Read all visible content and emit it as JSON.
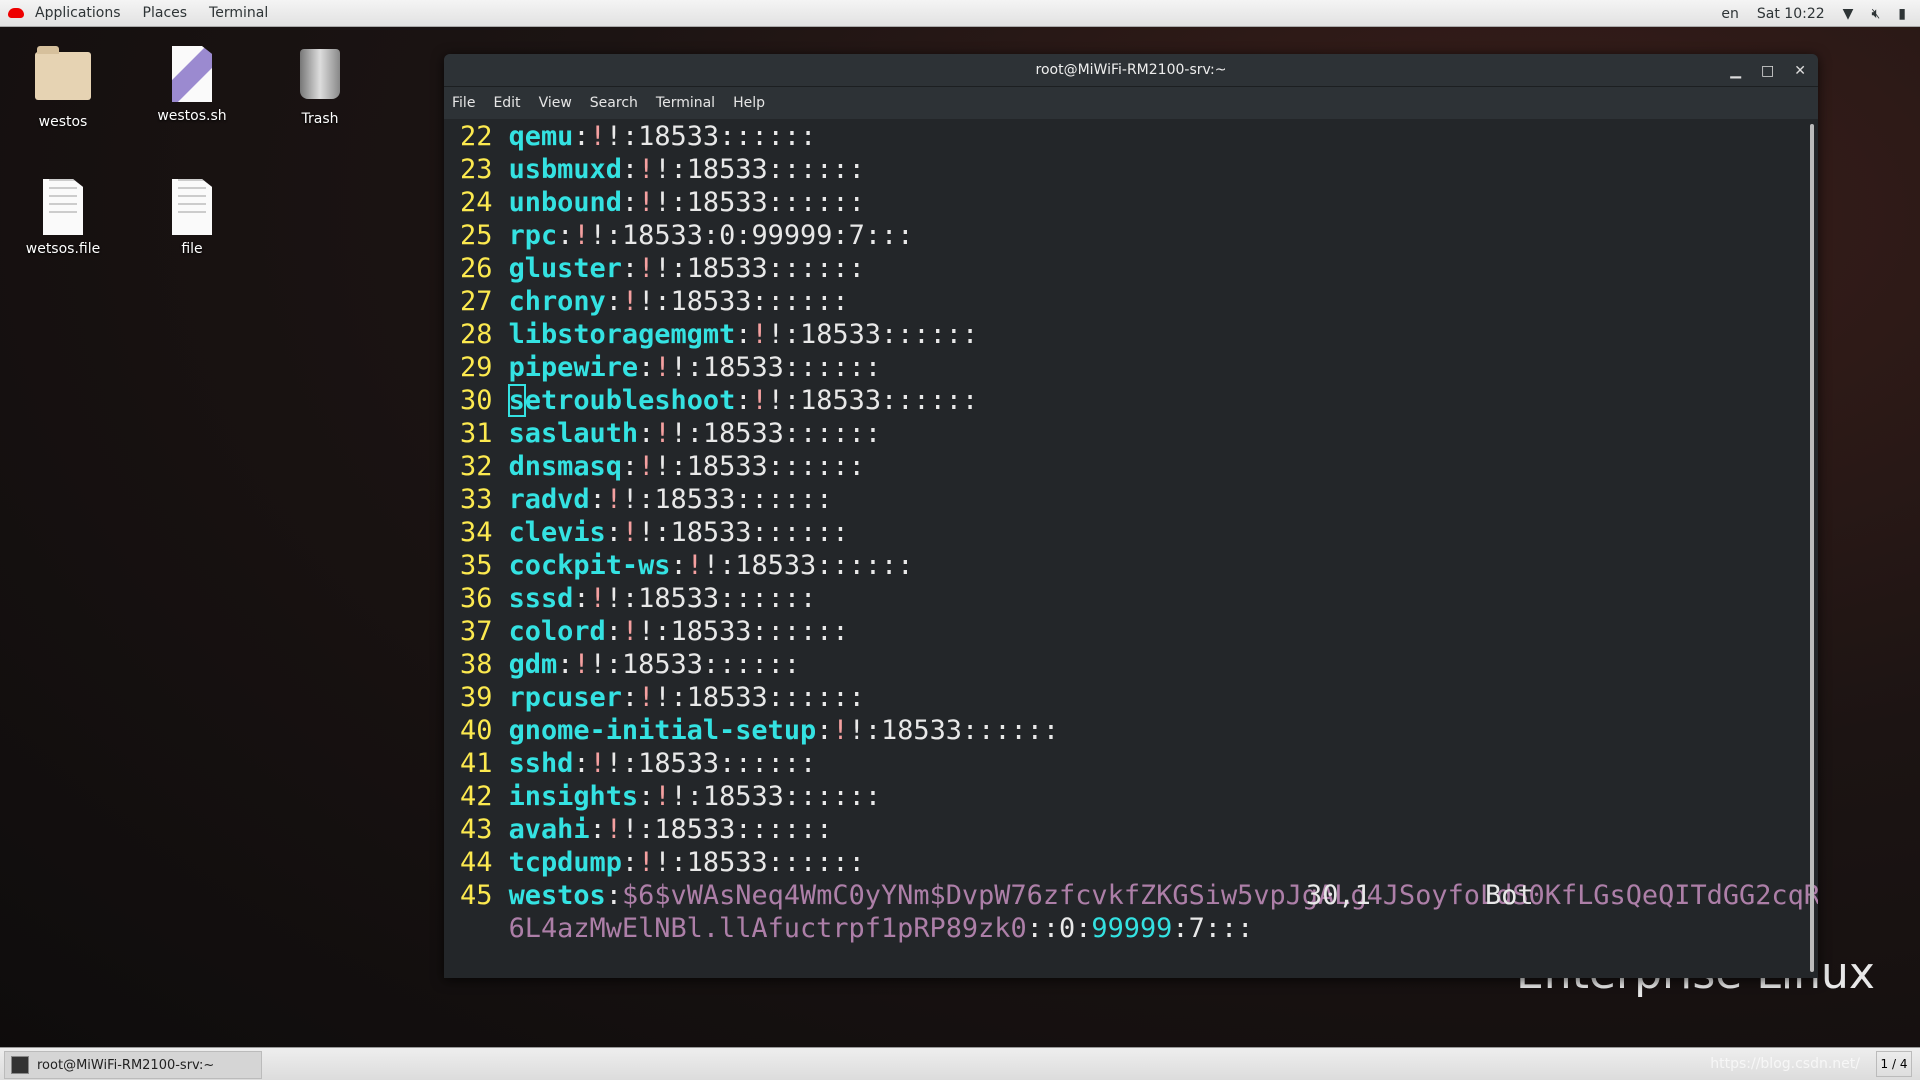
{
  "topbar": {
    "applications": "Applications",
    "places": "Places",
    "terminal": "Terminal",
    "lang": "en",
    "clock": "Sat 10:22",
    "icons": [
      "wifi-icon",
      "volume-muted-icon",
      "battery-icon"
    ]
  },
  "desktop": [
    {
      "label": "westos",
      "icon": "home-folder-icon"
    },
    {
      "label": "westos.sh",
      "icon": "script-file-icon"
    },
    {
      "label": "Trash",
      "icon": "trash-icon"
    },
    {
      "label": "wetsos.file",
      "icon": "text-file-icon"
    },
    {
      "label": "file",
      "icon": "text-file-icon"
    }
  ],
  "window": {
    "title": "root@MiWiFi-RM2100-srv:~",
    "menu": [
      "File",
      "Edit",
      "View",
      "Search",
      "Terminal",
      "Help"
    ]
  },
  "lines": [
    {
      "n": "22",
      "user": "qemu",
      "rest": ":18533::::::"
    },
    {
      "n": "23",
      "user": "usbmuxd",
      "rest": ":18533::::::"
    },
    {
      "n": "24",
      "user": "unbound",
      "rest": ":18533::::::"
    },
    {
      "n": "25",
      "user": "rpc",
      "rest": ":18533:0:99999:7:::"
    },
    {
      "n": "26",
      "user": "gluster",
      "rest": ":18533::::::"
    },
    {
      "n": "27",
      "user": "chrony",
      "rest": ":18533::::::"
    },
    {
      "n": "28",
      "user": "libstoragemgmt",
      "rest": ":18533::::::"
    },
    {
      "n": "29",
      "user": "pipewire",
      "rest": ":18533::::::"
    },
    {
      "n": "30",
      "user": "setroubleshoot",
      "rest": ":18533::::::"
    },
    {
      "n": "31",
      "user": "saslauth",
      "rest": ":18533::::::"
    },
    {
      "n": "32",
      "user": "dnsmasq",
      "rest": ":18533::::::"
    },
    {
      "n": "33",
      "user": "radvd",
      "rest": ":18533::::::"
    },
    {
      "n": "34",
      "user": "clevis",
      "rest": ":18533::::::"
    },
    {
      "n": "35",
      "user": "cockpit-ws",
      "rest": ":18533::::::"
    },
    {
      "n": "36",
      "user": "sssd",
      "rest": ":18533::::::"
    },
    {
      "n": "37",
      "user": "colord",
      "rest": ":18533::::::"
    },
    {
      "n": "38",
      "user": "gdm",
      "rest": ":18533::::::"
    },
    {
      "n": "39",
      "user": "rpcuser",
      "rest": ":18533::::::"
    },
    {
      "n": "40",
      "user": "gnome-initial-setup",
      "rest": ":18533::::::"
    },
    {
      "n": "41",
      "user": "sshd",
      "rest": ":18533::::::"
    },
    {
      "n": "42",
      "user": "insights",
      "rest": ":18533::::::"
    },
    {
      "n": "43",
      "user": "avahi",
      "rest": ":18533::::::"
    },
    {
      "n": "44",
      "user": "tcpdump",
      "rest": ":18533::::::"
    }
  ],
  "last": {
    "n": "45",
    "user": "westos",
    "hash1": "$6$vWAsNeq4WmC0yYNm$DvpW76zfcvkfZKGSiw5vpJgALg4JSoyfoLdS0KfLGsQeQITdGG2cqR",
    "hash2": "6L4azMwElNBl.llAfuctrpf1pRP89zk0",
    "mid": "::0:",
    "max": "99999",
    "tail": ":7:::"
  },
  "status": {
    "position": "30,1",
    "scroll": "Bot"
  },
  "wallpaper_logo": "Enterprise Linux",
  "taskbar": {
    "task": "root@MiWiFi-RM2100-srv:~",
    "watermark": "https://blog.csdn.net/",
    "workspace": "1 / 4"
  }
}
